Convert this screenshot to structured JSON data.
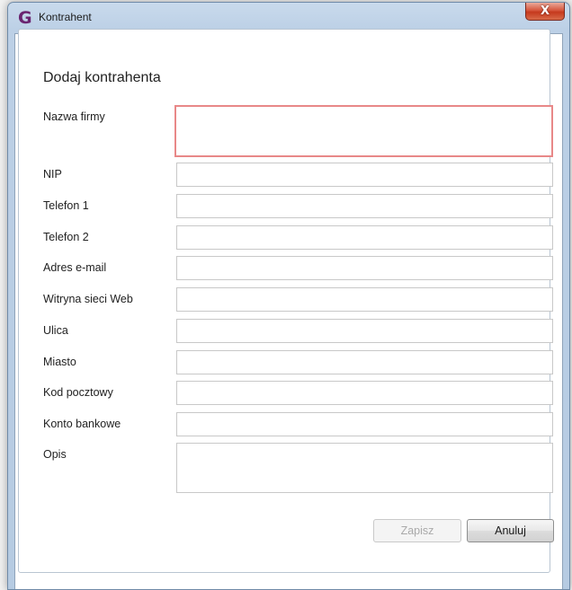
{
  "window": {
    "title": "Kontrahent",
    "app_icon_glyph": "G",
    "close_glyph": "X"
  },
  "form": {
    "heading": "Dodaj kontrahenta",
    "fields": [
      {
        "label": "Nazwa firmy",
        "value": ""
      },
      {
        "label": "NIP",
        "value": ""
      },
      {
        "label": "Telefon 1",
        "value": ""
      },
      {
        "label": "Telefon 2",
        "value": ""
      },
      {
        "label": "Adres e-mail",
        "value": ""
      },
      {
        "label": "Witryna sieci Web",
        "value": ""
      },
      {
        "label": "Ulica",
        "value": ""
      },
      {
        "label": "Miasto",
        "value": ""
      },
      {
        "label": "Kod pocztowy",
        "value": ""
      },
      {
        "label": "Konto bankowe",
        "value": ""
      },
      {
        "label": "Opis",
        "value": ""
      }
    ]
  },
  "buttons": {
    "save_label": "Zapisz",
    "cancel_label": "Anuluj"
  },
  "colors": {
    "accent": "#6a2470",
    "invalid_border": "#e88888",
    "close_button": "#c5391d"
  }
}
